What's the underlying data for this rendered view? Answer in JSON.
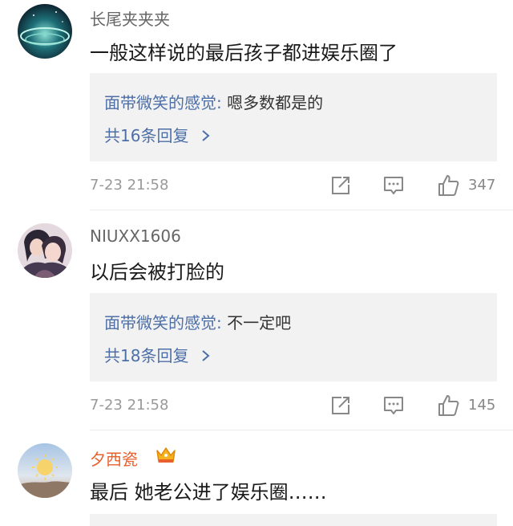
{
  "comments": [
    {
      "username": "长尾夹夹夹",
      "text": "一般这样说的最后孩子都进娱乐圈了",
      "reply_author": "面带微笑的感觉",
      "reply_text": "嗯多数都是的",
      "more_replies": "共16条回复",
      "timestamp": "7-23 21:58",
      "likes": "347"
    },
    {
      "username": "NIUXX1606",
      "text": "以后会被打脸的",
      "reply_author": "面带微笑的感觉",
      "reply_text": "不一定吧",
      "more_replies": "共18条回复",
      "timestamp": "7-23 21:58",
      "likes": "145"
    },
    {
      "username": "夕西瓷",
      "text": "最后 她老公进了娱乐圈……"
    }
  ],
  "icons": {
    "share": "share-icon",
    "comment": "comment-icon",
    "like": "thumbs-up-icon",
    "chevron": "chevron-right-icon",
    "crown": "crown-icon"
  },
  "colors": {
    "link_blue": "#4d6fa8",
    "vip_orange": "#e8602c",
    "reply_bg": "#f2f2f2",
    "meta_gray": "#999999"
  }
}
